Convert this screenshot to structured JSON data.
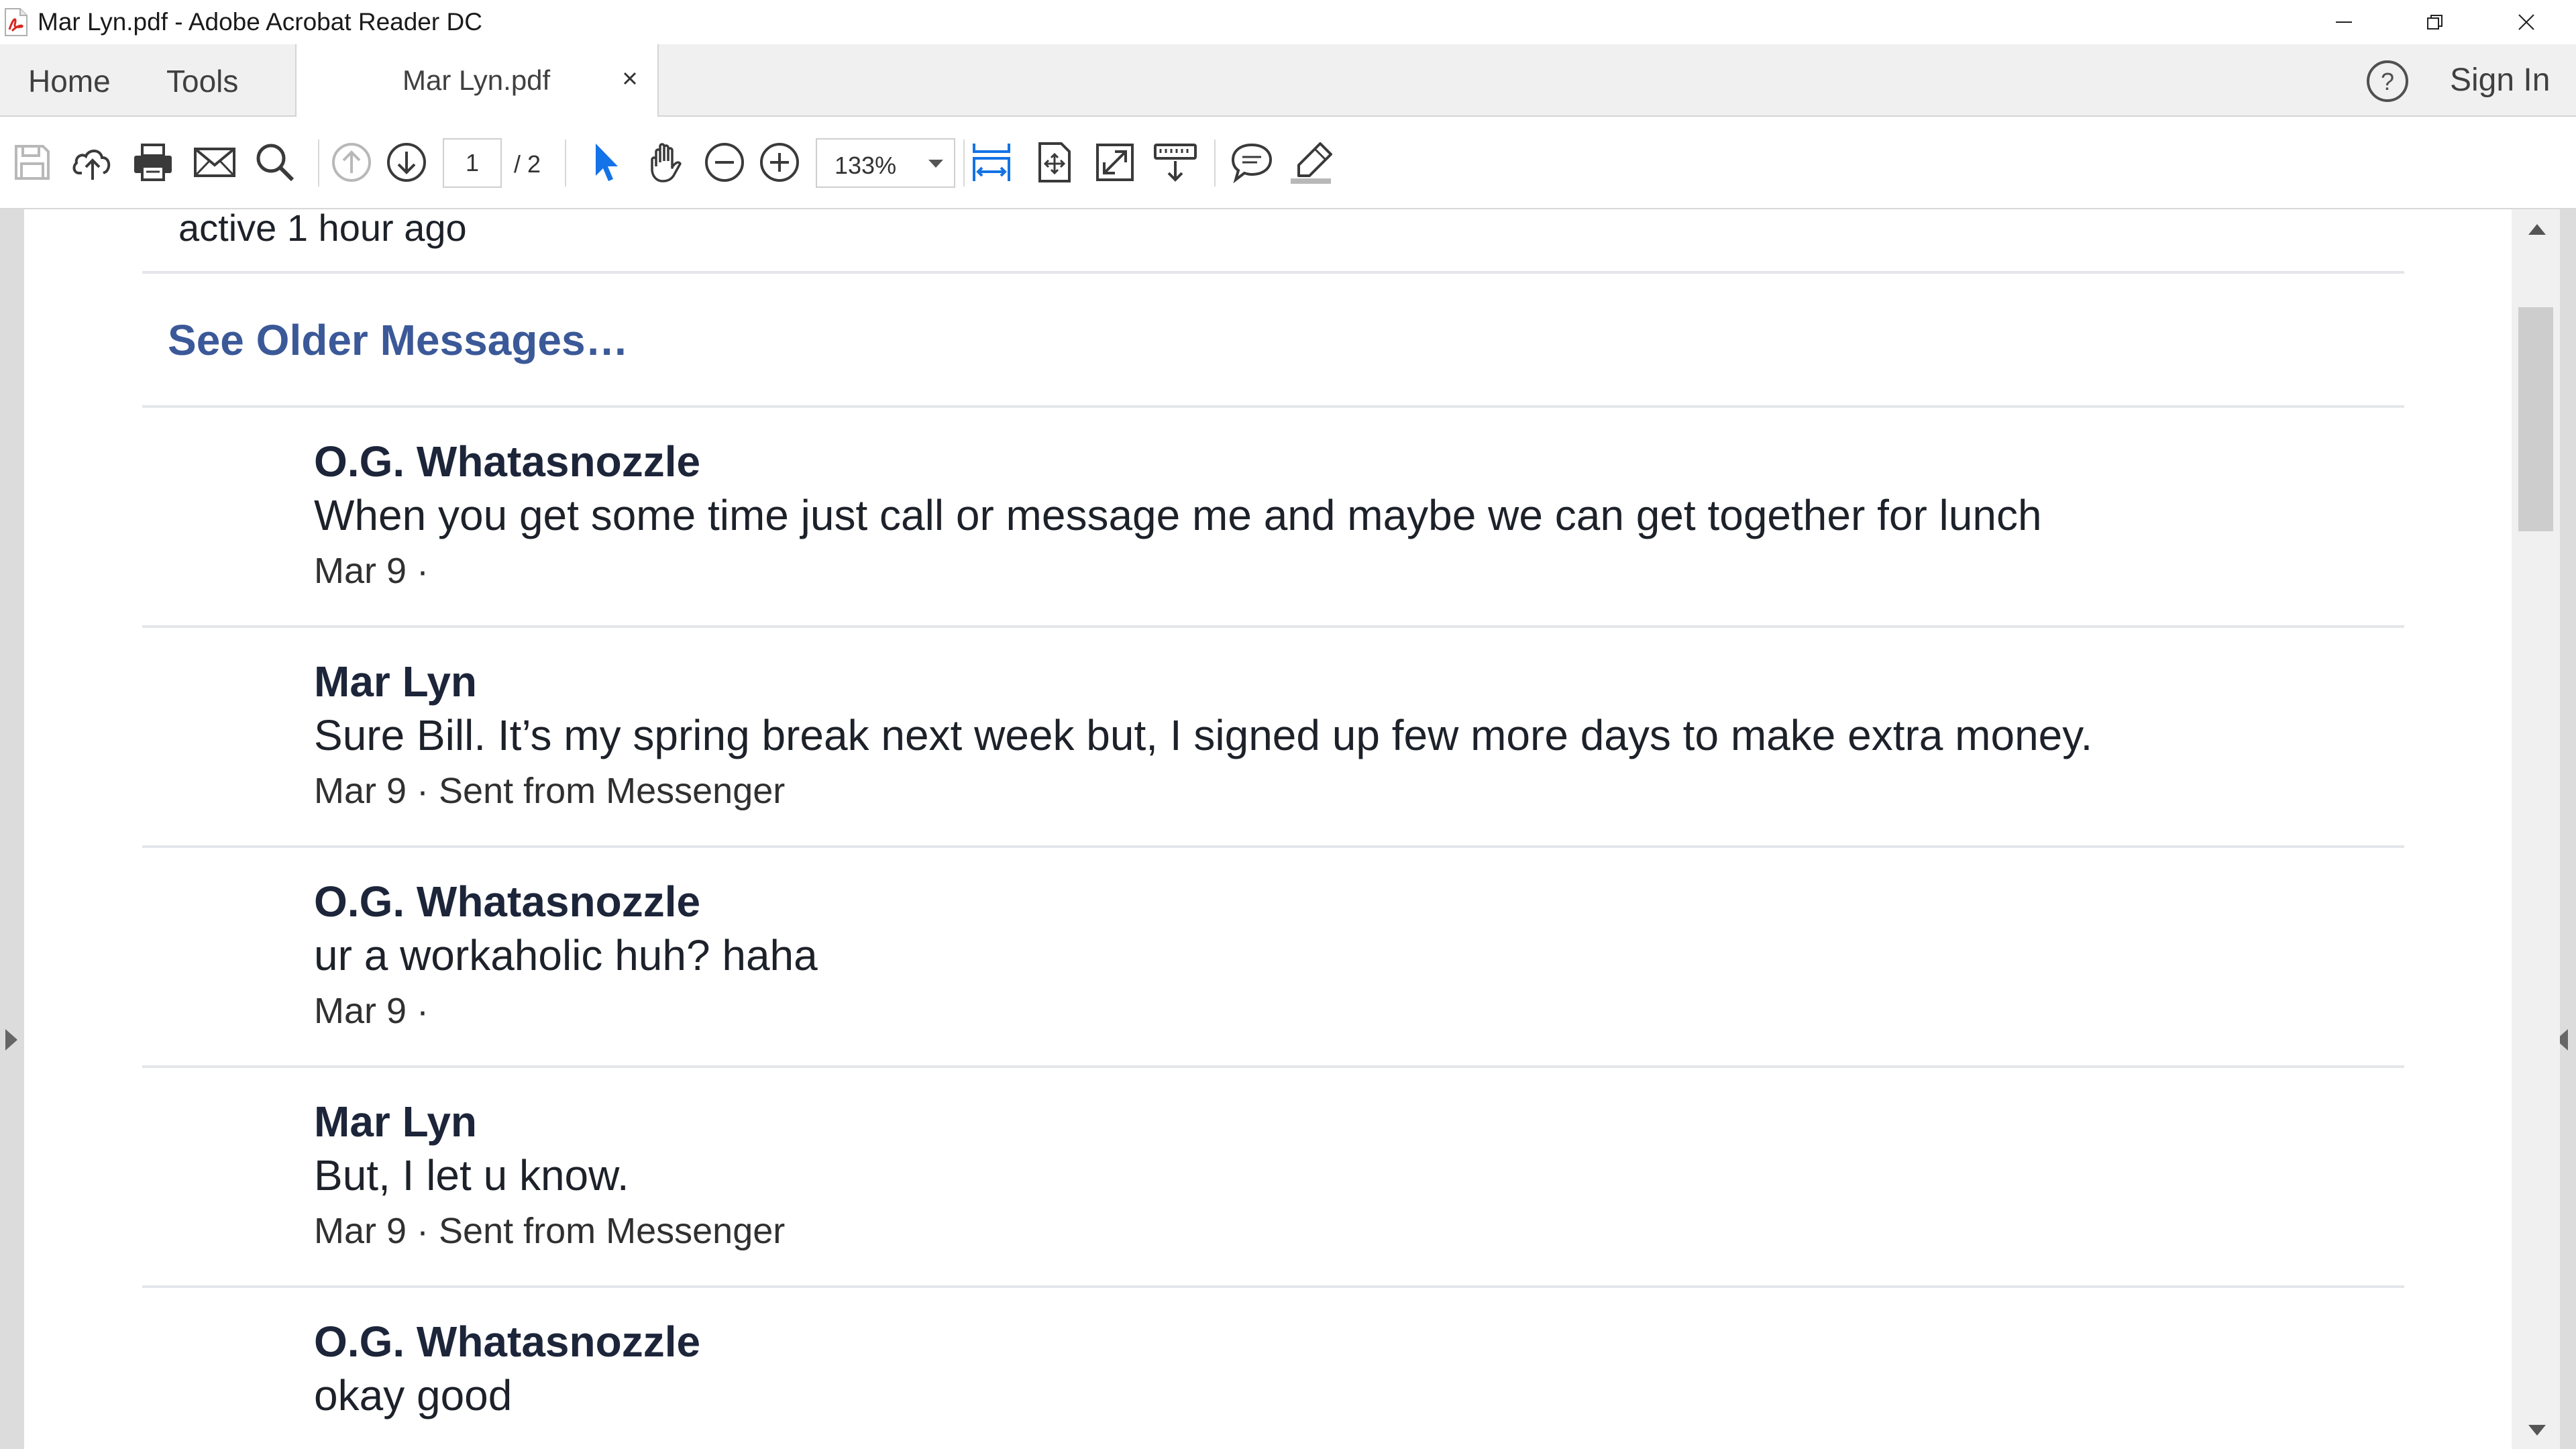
{
  "window": {
    "title": "Mar Lyn.pdf - Adobe Acrobat Reader DC",
    "controls": [
      "minimize",
      "restore",
      "close"
    ]
  },
  "tabbar": {
    "home_label": "Home",
    "tools_label": "Tools",
    "document_tab_label": "Mar Lyn.pdf",
    "sign_in_label": "Sign In"
  },
  "toolbar": {
    "icons": [
      "save-icon",
      "upload-icon",
      "print-icon",
      "email-icon",
      "search-icon",
      "prev-page-icon",
      "next-page-icon",
      "select-cursor-icon",
      "hand-tool-icon",
      "zoom-out-icon",
      "zoom-in-icon",
      "fit-width-icon",
      "fit-page-icon",
      "full-screen-icon",
      "read-mode-icon",
      "comment-icon",
      "highlight-pen-icon"
    ],
    "current_page": "1",
    "page_total": "/ 2",
    "zoom": "133%"
  },
  "colors": {
    "link": "#3b5998",
    "author": "#1c2539",
    "active_tool": "#1473e6",
    "divider": "#e4e6eb"
  },
  "document": {
    "active_status": "active 1 hour ago",
    "see_older_label": "See Older Messages…",
    "messages": [
      {
        "author": "O.G. Whatasnozzle",
        "text": "When you get some time just call or message me and maybe we can get together for lunch",
        "meta": "Mar 9 ·"
      },
      {
        "author": "Mar Lyn",
        "text": "Sure Bill. It’s my spring break next week but, I signed up few more days to make extra money.",
        "meta": "Mar 9 · Sent from Messenger"
      },
      {
        "author": "O.G. Whatasnozzle",
        "text": "ur a workaholic huh? haha",
        "meta": "Mar 9 ·"
      },
      {
        "author": "Mar Lyn",
        "text": "But, I let u know.",
        "meta": "Mar 9 · Sent from Messenger"
      },
      {
        "author": "O.G. Whatasnozzle",
        "text": "okay good",
        "meta": ""
      }
    ]
  }
}
